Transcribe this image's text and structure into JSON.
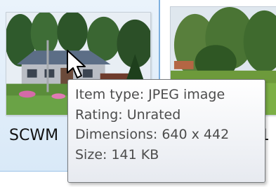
{
  "files": [
    {
      "name": "SCWM",
      "thumbnail_icon": "house-photo-thumbnail",
      "selected": true
    },
    {
      "name": "1",
      "thumbnail_icon": "landscape-photo-thumbnail",
      "selected": false
    }
  ],
  "tooltip": {
    "lines": [
      "Item type: JPEG image",
      "Rating: Unrated",
      "Dimensions: 640 x 442",
      "Size: 141 KB"
    ]
  },
  "colors": {
    "selection_bg": "#dce9f7",
    "selection_border": "#7fb1e0",
    "tooltip_text": "#4c4c4c"
  }
}
